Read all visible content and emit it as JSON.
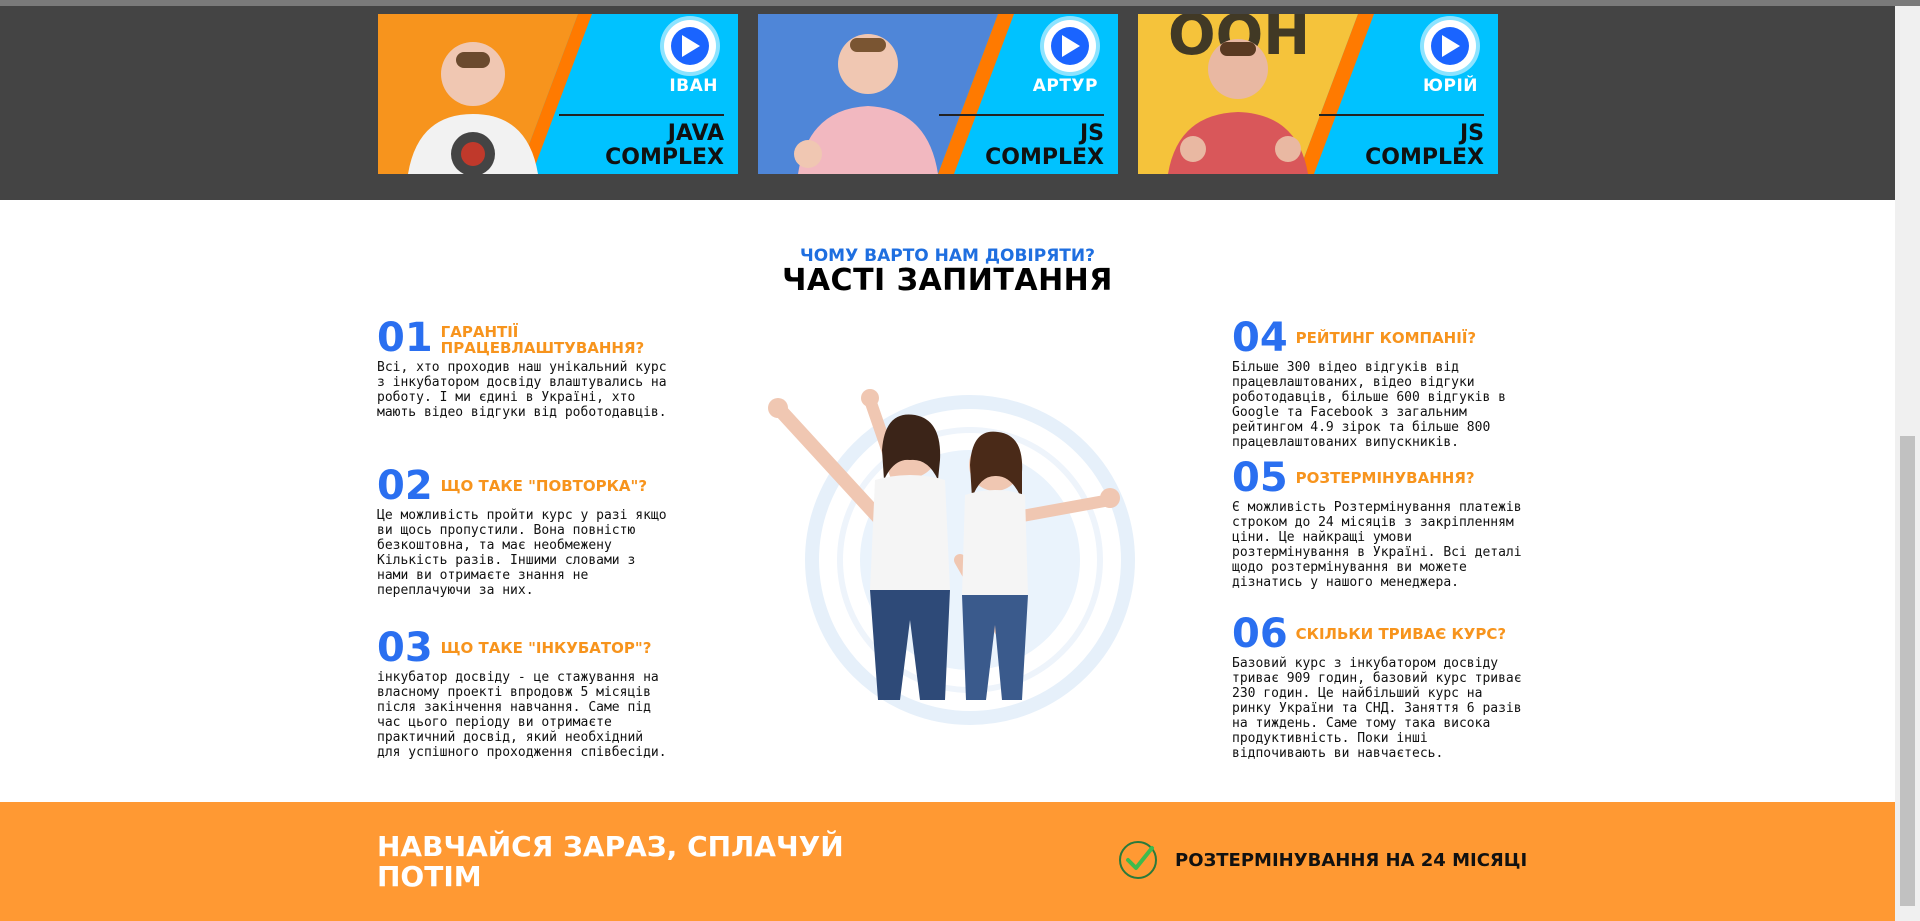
{
  "videos": [
    {
      "name": "ІВАН",
      "course_line1": "JAVA",
      "course_line2": "COMPLEX",
      "bg": "#f7941d"
    },
    {
      "name": "АРТУР",
      "course_line1": "JS",
      "course_line2": "COMPLEX",
      "bg": "#4f86d8"
    },
    {
      "name": "ЮРІЙ",
      "course_line1": "JS",
      "course_line2": "COMPLEX",
      "bg": "#f5c33b"
    }
  ],
  "faq": {
    "subtitle": "ЧОМУ ВАРТО НАМ ДОВІРЯТИ?",
    "title": "ЧАСТІ ЗАПИТАННЯ",
    "items": [
      {
        "num": "01",
        "question": "ГАРАНТІЇ ПРАЦЕВЛАШТУВАННЯ?",
        "answer": "Всі, хто проходив наш унікальний курс з інкубатором досвіду влаштувались на роботу. І ми єдині в Україні, хто мають відео відгуки від роботодавців."
      },
      {
        "num": "02",
        "question": "ЩО ТАКЕ \"ПОВТОРКА\"?",
        "answer": "Це можливість пройти курс у разі якщо ви щось пропустили. Вона повністю безкоштовна, та має необмежену Кількість разів. Іншими словами з нами ви отримаєте знання не переплачуючи за них."
      },
      {
        "num": "03",
        "question": "ЩО ТАКЕ \"ІНКУБАТОР\"?",
        "answer": "інкубатор досвіду - це стажування на власному проекті впродовж 5 місяців після закінчення навчання. Саме під час цього періоду ви отримаєте практичний досвід, який необхідний для успішного проходження співбесіди."
      },
      {
        "num": "04",
        "question": "РЕЙТИНГ КОМПАНІЇ?",
        "answer": "Більше 300 відео відгуків від працевлаштованих, відео відгуки роботодавців, більше 600 відгуків в Google та Facebook з загальним рейтингом 4.9 зірок та більше 800 працевлаштованих випускників."
      },
      {
        "num": "05",
        "question": "РОЗТЕРМІНУВАННЯ?",
        "answer": "Є можливість Розтермінування платежів строком до 24 місяців з закріпленням ціни. Це найкращі умови розтермінування в Україні. Всі деталі щодо розтермінування ви можете дізнатись у нашого менеджера."
      },
      {
        "num": "06",
        "question": "СКІЛЬКИ ТРИВАЄ КУРС?",
        "answer": "Базовий курс з інкубатором досвіду триває 909 годин, базовий курс триває 230 годин. Це найбільший курс на ринку України та СНД. Заняття 6 разів на тиждень. Саме тому така висока продуктивність. Поки інші відпочивають ви навчаєтесь."
      }
    ]
  },
  "cta": {
    "headline": "НАВЧАЙСЯ ЗАРАЗ, СПЛАЧУЙ ПОТІМ",
    "installment": "РОЗТЕРМІНУВАННЯ НА 24 МІСЯЦІ"
  },
  "colors": {
    "accent_blue": "#2a6ff0",
    "accent_orange": "#f7941d",
    "cta_bg": "#ff9933",
    "dark_band": "#444444"
  }
}
